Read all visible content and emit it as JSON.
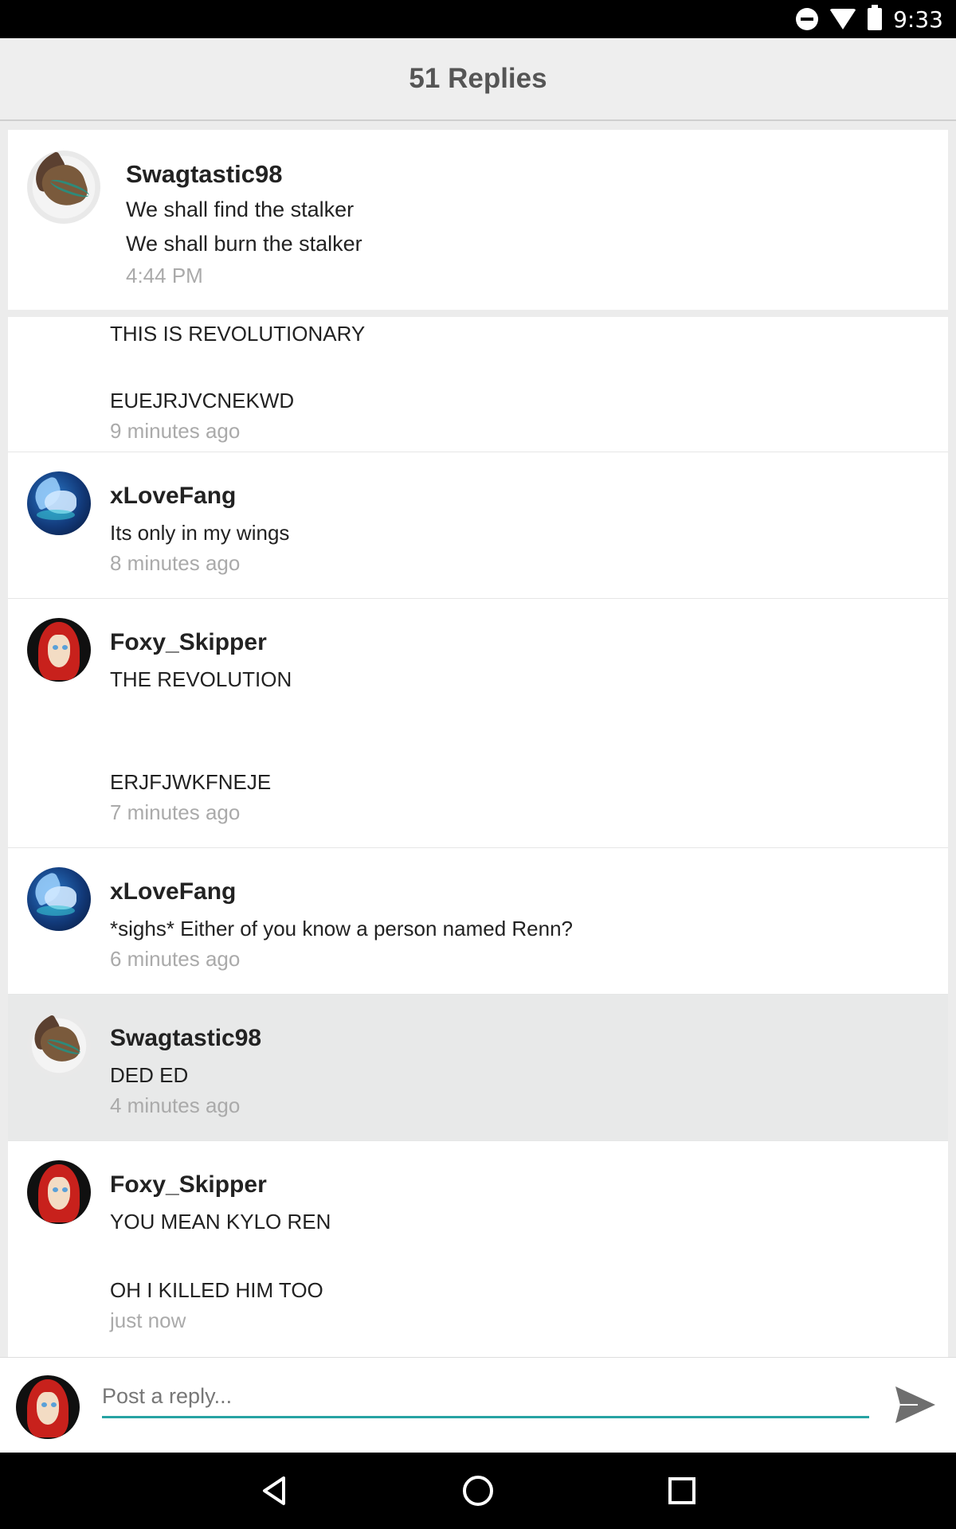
{
  "status_bar": {
    "time": "9:33",
    "icons": [
      "dnd-icon",
      "wifi-icon",
      "battery-icon"
    ]
  },
  "header": {
    "title": "51 Replies"
  },
  "post": {
    "author": "Swagtastic98",
    "lines": [
      "We shall find the stalker",
      "We shall burn the stalker"
    ],
    "time": "4:44 PM"
  },
  "replies": [
    {
      "lines": [
        "THIS IS REVOLUTIONARY",
        "EUEJRJVCNEKWD"
      ],
      "time": "9 minutes ago"
    },
    {
      "author": "xLoveFang",
      "lines": [
        "Its only in my wings"
      ],
      "time": "8 minutes ago"
    },
    {
      "author": "Foxy_Skipper",
      "lines": [
        "THE REVOLUTION",
        "ERJFJWKFNEJE"
      ],
      "time": "7 minutes ago"
    },
    {
      "author": "xLoveFang",
      "lines": [
        "*sighs* Either of you know a person named Renn?"
      ],
      "time": "6 minutes ago"
    },
    {
      "author": "Swagtastic98",
      "lines": [
        "DED ED"
      ],
      "time": "4 minutes ago"
    },
    {
      "author": "Foxy_Skipper",
      "lines": [
        "YOU MEAN KYLO REN",
        "OH I KILLED HIM TOO"
      ],
      "time": "just now"
    }
  ],
  "reply_bar": {
    "placeholder": "Post a reply..."
  },
  "nav": [
    "back-icon",
    "home-icon",
    "recents-icon"
  ],
  "colors": {
    "accent": "#27a3a3",
    "highlight_row": "#e8e9e9",
    "timestamp": "#aaaaaa"
  }
}
